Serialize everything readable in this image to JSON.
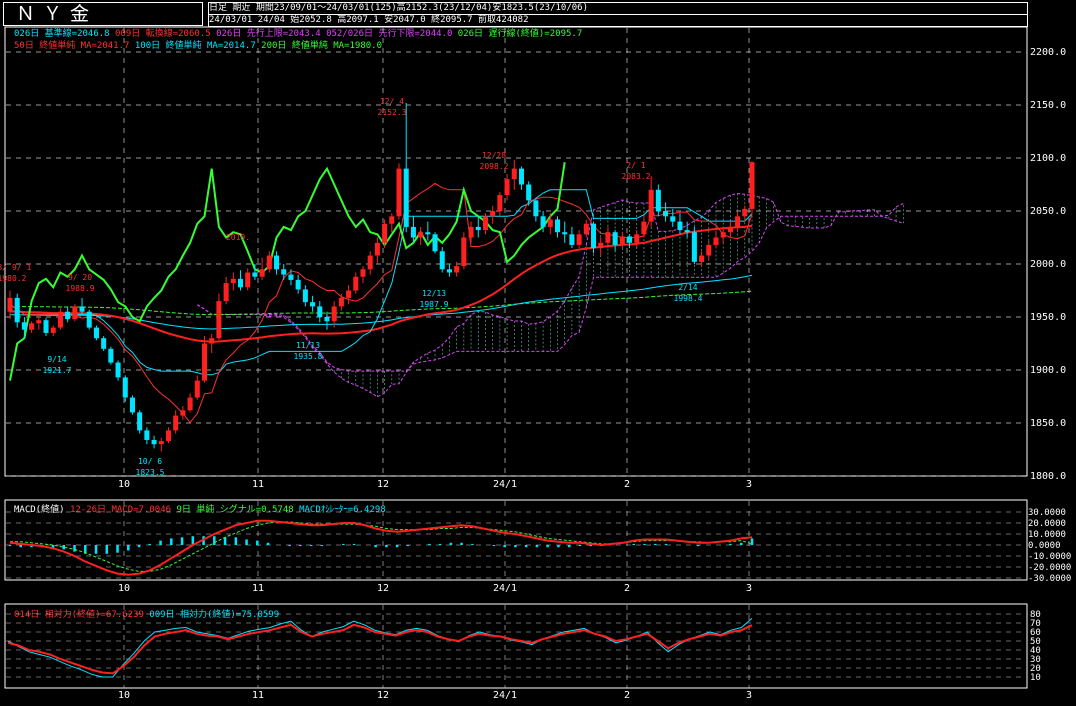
{
  "header": {
    "title": "ＮＹ金",
    "period_label": "日足 期近",
    "range_info": "期間23/09/01～24/03/01(125)高2152.3(23/12/04)安1823.5(23/10/06)",
    "ohlc_info": "24/03/01 24/04 始2052.8 高2097.1 安2047.0 終2095.7 前取424082"
  },
  "legends": {
    "ichimoku": [
      {
        "text": "026日 基準線=2046.8",
        "color": "#00e5ff"
      },
      {
        "text": "009日 転換線=2060.5",
        "color": "#ff3030"
      },
      {
        "text": "026日 先行上限=2043.4",
        "color": "#e040fb"
      },
      {
        "text": "052/026日 先行下限=2044.0",
        "color": "#e040fb"
      },
      {
        "text": "026日 遅行線(終値)=2095.7",
        "color": "#33ff33"
      }
    ],
    "ma": [
      {
        "text": "50日 終値単純 MA=2041.7",
        "color": "#ff3030"
      },
      {
        "text": "100日 終値単純 MA=2014.7",
        "color": "#00e5ff"
      },
      {
        "text": "200日 終値単純 MA=1980.0",
        "color": "#33ff33"
      }
    ],
    "macd": [
      {
        "text": "MACD(終値)",
        "color": "#ffffff"
      },
      {
        "text": "12-26日 MACD=7.0046",
        "color": "#ff3030"
      },
      {
        "text": "9日 単純 シグナル=0.5748",
        "color": "#33ff33"
      },
      {
        "text": "MACDｵｼﾚｰﾀｰ=6.4298",
        "color": "#00e5ff"
      }
    ],
    "rsi": [
      {
        "text": "014日 相対力(終値)=67.6239",
        "color": "#ff3030"
      },
      {
        "text": "009日 相対力(終値)=75.0599",
        "color": "#00e5ff"
      }
    ]
  },
  "colors": {
    "up": "#ff2020",
    "down": "#00e5ff",
    "ma50": "#ff2020",
    "ma100": "#00e5ff",
    "ma200": "#33ff33",
    "kijun": "#00e5ff",
    "tenkan": "#ff3030",
    "chikou": "#33ff33",
    "cloud": "#e040fb",
    "grid": "#cccccc"
  },
  "chart_data": [
    {
      "type": "candlestick",
      "title": "ＮＹ金",
      "ylim": [
        1800,
        2200
      ],
      "y_ticks": [
        "2200.0",
        "2150.0",
        "2100.0",
        "2050.0",
        "2000.0",
        "1950.0",
        "1900.0",
        "1850.0",
        "1800.0"
      ],
      "x_ticks": [
        "10",
        "11",
        "12",
        "24/1",
        "2",
        "3"
      ],
      "annotations": [
        "23/ 9/ 1 1980.2",
        "9/ 20 1988.9",
        "9/14 1921.7",
        "10/ 6 1823.5",
        "2019.",
        "11/13 1935.8",
        "12/ 4 2152.3",
        "12/13 1987.9",
        "12/28 2098.2",
        "2/ 1 2083.2",
        "2/14 1998.4"
      ],
      "candles": [
        {
          "o": 1955,
          "h": 1975,
          "l": 1948,
          "c": 1968
        },
        {
          "o": 1968,
          "h": 1972,
          "l": 1940,
          "c": 1945
        },
        {
          "o": 1945,
          "h": 1950,
          "l": 1930,
          "c": 1938
        },
        {
          "o": 1938,
          "h": 1946,
          "l": 1935,
          "c": 1944
        },
        {
          "o": 1944,
          "h": 1950,
          "l": 1938,
          "c": 1947
        },
        {
          "o": 1947,
          "h": 1949,
          "l": 1932,
          "c": 1935
        },
        {
          "o": 1935,
          "h": 1942,
          "l": 1932,
          "c": 1940
        },
        {
          "o": 1940,
          "h": 1958,
          "l": 1938,
          "c": 1955
        },
        {
          "o": 1955,
          "h": 1960,
          "l": 1945,
          "c": 1948
        },
        {
          "o": 1948,
          "h": 1962,
          "l": 1946,
          "c": 1960
        },
        {
          "o": 1960,
          "h": 1968,
          "l": 1952,
          "c": 1955
        },
        {
          "o": 1955,
          "h": 1957,
          "l": 1938,
          "c": 1940
        },
        {
          "o": 1940,
          "h": 1942,
          "l": 1928,
          "c": 1930
        },
        {
          "o": 1930,
          "h": 1932,
          "l": 1918,
          "c": 1920
        },
        {
          "o": 1920,
          "h": 1922,
          "l": 1905,
          "c": 1907
        },
        {
          "o": 1907,
          "h": 1909,
          "l": 1890,
          "c": 1893
        },
        {
          "o": 1893,
          "h": 1895,
          "l": 1870,
          "c": 1874
        },
        {
          "o": 1874,
          "h": 1876,
          "l": 1858,
          "c": 1860
        },
        {
          "o": 1860,
          "h": 1862,
          "l": 1840,
          "c": 1843
        },
        {
          "o": 1843,
          "h": 1846,
          "l": 1830,
          "c": 1834
        },
        {
          "o": 1834,
          "h": 1838,
          "l": 1826,
          "c": 1830
        },
        {
          "o": 1830,
          "h": 1836,
          "l": 1823,
          "c": 1833
        },
        {
          "o": 1833,
          "h": 1846,
          "l": 1831,
          "c": 1843
        },
        {
          "o": 1843,
          "h": 1862,
          "l": 1840,
          "c": 1857
        },
        {
          "o": 1857,
          "h": 1866,
          "l": 1853,
          "c": 1862
        },
        {
          "o": 1862,
          "h": 1878,
          "l": 1860,
          "c": 1874
        },
        {
          "o": 1874,
          "h": 1895,
          "l": 1872,
          "c": 1890
        },
        {
          "o": 1890,
          "h": 1932,
          "l": 1888,
          "c": 1925
        },
        {
          "o": 1925,
          "h": 1934,
          "l": 1916,
          "c": 1930
        },
        {
          "o": 1930,
          "h": 1972,
          "l": 1928,
          "c": 1965
        },
        {
          "o": 1965,
          "h": 1988,
          "l": 1962,
          "c": 1982
        },
        {
          "o": 1982,
          "h": 1992,
          "l": 1975,
          "c": 1986
        },
        {
          "o": 1986,
          "h": 1994,
          "l": 1975,
          "c": 1978
        },
        {
          "o": 1978,
          "h": 1996,
          "l": 1975,
          "c": 1992
        },
        {
          "o": 1992,
          "h": 2000,
          "l": 1985,
          "c": 1988
        },
        {
          "o": 1988,
          "h": 2006,
          "l": 1985,
          "c": 1995
        },
        {
          "o": 1995,
          "h": 2012,
          "l": 1992,
          "c": 2008
        },
        {
          "o": 2008,
          "h": 2012,
          "l": 1990,
          "c": 1995
        },
        {
          "o": 1995,
          "h": 2000,
          "l": 1985,
          "c": 1990
        },
        {
          "o": 1990,
          "h": 1995,
          "l": 1980,
          "c": 1985
        },
        {
          "o": 1985,
          "h": 1990,
          "l": 1972,
          "c": 1976
        },
        {
          "o": 1976,
          "h": 1980,
          "l": 1960,
          "c": 1964
        },
        {
          "o": 1964,
          "h": 1970,
          "l": 1955,
          "c": 1960
        },
        {
          "o": 1960,
          "h": 1965,
          "l": 1945,
          "c": 1950
        },
        {
          "o": 1950,
          "h": 1955,
          "l": 1938,
          "c": 1946
        },
        {
          "o": 1946,
          "h": 1965,
          "l": 1940,
          "c": 1960
        },
        {
          "o": 1960,
          "h": 1972,
          "l": 1956,
          "c": 1968
        },
        {
          "o": 1968,
          "h": 1980,
          "l": 1962,
          "c": 1975
        },
        {
          "o": 1975,
          "h": 1992,
          "l": 1972,
          "c": 1988
        },
        {
          "o": 1988,
          "h": 1998,
          "l": 1982,
          "c": 1995
        },
        {
          "o": 1995,
          "h": 2012,
          "l": 1990,
          "c": 2008
        },
        {
          "o": 2008,
          "h": 2025,
          "l": 2000,
          "c": 2020
        },
        {
          "o": 2020,
          "h": 2042,
          "l": 2015,
          "c": 2038
        },
        {
          "o": 2038,
          "h": 2048,
          "l": 2030,
          "c": 2045
        },
        {
          "o": 2045,
          "h": 2095,
          "l": 2042,
          "c": 2090
        },
        {
          "o": 2090,
          "h": 2152,
          "l": 2030,
          "c": 2035
        },
        {
          "o": 2035,
          "h": 2045,
          "l": 2020,
          "c": 2025
        },
        {
          "o": 2025,
          "h": 2035,
          "l": 2018,
          "c": 2030
        },
        {
          "o": 2030,
          "h": 2040,
          "l": 2022,
          "c": 2028
        },
        {
          "o": 2028,
          "h": 2030,
          "l": 2010,
          "c": 2012
        },
        {
          "o": 2012,
          "h": 2016,
          "l": 1992,
          "c": 1995
        },
        {
          "o": 1995,
          "h": 2000,
          "l": 1988,
          "c": 1992
        },
        {
          "o": 1992,
          "h": 2002,
          "l": 1988,
          "c": 1998
        },
        {
          "o": 1998,
          "h": 2030,
          "l": 1995,
          "c": 2025
        },
        {
          "o": 2025,
          "h": 2040,
          "l": 2020,
          "c": 2035
        },
        {
          "o": 2035,
          "h": 2045,
          "l": 2025,
          "c": 2032
        },
        {
          "o": 2032,
          "h": 2048,
          "l": 2028,
          "c": 2045
        },
        {
          "o": 2045,
          "h": 2055,
          "l": 2038,
          "c": 2050
        },
        {
          "o": 2050,
          "h": 2068,
          "l": 2045,
          "c": 2065
        },
        {
          "o": 2065,
          "h": 2085,
          "l": 2060,
          "c": 2080
        },
        {
          "o": 2080,
          "h": 2098,
          "l": 2070,
          "c": 2090
        },
        {
          "o": 2090,
          "h": 2092,
          "l": 2070,
          "c": 2075
        },
        {
          "o": 2075,
          "h": 2078,
          "l": 2055,
          "c": 2060
        },
        {
          "o": 2060,
          "h": 2062,
          "l": 2040,
          "c": 2045
        },
        {
          "o": 2045,
          "h": 2050,
          "l": 2030,
          "c": 2035
        },
        {
          "o": 2035,
          "h": 2048,
          "l": 2028,
          "c": 2042
        },
        {
          "o": 2042,
          "h": 2045,
          "l": 2025,
          "c": 2030
        },
        {
          "o": 2030,
          "h": 2040,
          "l": 2020,
          "c": 2028
        },
        {
          "o": 2028,
          "h": 2035,
          "l": 2015,
          "c": 2018
        },
        {
          "o": 2018,
          "h": 2032,
          "l": 2015,
          "c": 2028
        },
        {
          "o": 2028,
          "h": 2042,
          "l": 2025,
          "c": 2038
        },
        {
          "o": 2038,
          "h": 2040,
          "l": 2010,
          "c": 2015
        },
        {
          "o": 2015,
          "h": 2025,
          "l": 2008,
          "c": 2020
        },
        {
          "o": 2020,
          "h": 2035,
          "l": 2015,
          "c": 2030
        },
        {
          "o": 2030,
          "h": 2032,
          "l": 2012,
          "c": 2018
        },
        {
          "o": 2018,
          "h": 2030,
          "l": 2015,
          "c": 2026
        },
        {
          "o": 2026,
          "h": 2028,
          "l": 2015,
          "c": 2020
        },
        {
          "o": 2020,
          "h": 2032,
          "l": 2015,
          "c": 2028
        },
        {
          "o": 2028,
          "h": 2045,
          "l": 2025,
          "c": 2040
        },
        {
          "o": 2040,
          "h": 2083,
          "l": 2035,
          "c": 2070
        },
        {
          "o": 2070,
          "h": 2075,
          "l": 2045,
          "c": 2050
        },
        {
          "o": 2050,
          "h": 2058,
          "l": 2040,
          "c": 2045
        },
        {
          "o": 2045,
          "h": 2052,
          "l": 2035,
          "c": 2040
        },
        {
          "o": 2040,
          "h": 2048,
          "l": 2028,
          "c": 2032
        },
        {
          "o": 2032,
          "h": 2040,
          "l": 2025,
          "c": 2030
        },
        {
          "o": 2030,
          "h": 2035,
          "l": 2000,
          "c": 2002
        },
        {
          "o": 2002,
          "h": 2012,
          "l": 1998,
          "c": 2008
        },
        {
          "o": 2008,
          "h": 2022,
          "l": 2004,
          "c": 2018
        },
        {
          "o": 2018,
          "h": 2030,
          "l": 2015,
          "c": 2025
        },
        {
          "o": 2025,
          "h": 2035,
          "l": 2020,
          "c": 2030
        },
        {
          "o": 2030,
          "h": 2040,
          "l": 2025,
          "c": 2035
        },
        {
          "o": 2035,
          "h": 2050,
          "l": 2030,
          "c": 2045
        },
        {
          "o": 2045,
          "h": 2055,
          "l": 2040,
          "c": 2052
        },
        {
          "o": 2052,
          "h": 2097,
          "l": 2047,
          "c": 2096
        }
      ]
    },
    {
      "type": "line",
      "title": "MACD(終値)",
      "ylim": [
        -30,
        30
      ],
      "y_ticks": [
        "30.0000",
        "20.0000",
        "10.0000",
        "0.0000",
        "-10.0000",
        "-20.0000",
        "-30.0000"
      ],
      "series": [
        {
          "name": "12-26日 MACD",
          "values": [
            2,
            1,
            0,
            -1,
            -3,
            -6,
            -10,
            -15,
            -19,
            -23,
            -26,
            -27,
            -26,
            -23,
            -18,
            -12,
            -6,
            0,
            5,
            10,
            14,
            18,
            20,
            22,
            22,
            21,
            20,
            19,
            18,
            18,
            19,
            20,
            20,
            18,
            15,
            13,
            12,
            13,
            14,
            15,
            16,
            17,
            18,
            17,
            15,
            13,
            11,
            10,
            8,
            6,
            4,
            3,
            2,
            2,
            1,
            0,
            1,
            2,
            4,
            5,
            5,
            5,
            4,
            3,
            2,
            2,
            3,
            4,
            6,
            7
          ]
        },
        {
          "name": "9日 単純 シグナル",
          "values": [
            3,
            3,
            2,
            1,
            0,
            -2,
            -4,
            -7,
            -11,
            -15,
            -19,
            -22,
            -24,
            -24,
            -22,
            -18,
            -13,
            -8,
            -3,
            2,
            7,
            11,
            15,
            18,
            20,
            21,
            21,
            20,
            19,
            19,
            19,
            19,
            19,
            18,
            17,
            15,
            14,
            14,
            14,
            14,
            15,
            15,
            16,
            16,
            15,
            14,
            13,
            12,
            10,
            8,
            6,
            5,
            4,
            3,
            2,
            1,
            1,
            2,
            3,
            4,
            4,
            4,
            4,
            3,
            3,
            2,
            3,
            3,
            4,
            1
          ]
        },
        {
          "name": "MACDｵｼﾚｰﾀｰ",
          "values": [
            -1,
            -2,
            -2,
            -2,
            -3,
            -4,
            -6,
            -8,
            -8,
            -8,
            -7,
            -5,
            -2,
            1,
            4,
            6,
            7,
            8,
            8,
            8,
            7,
            7,
            5,
            4,
            2,
            0,
            -1,
            -1,
            -1,
            -1,
            0,
            1,
            1,
            0,
            -2,
            -2,
            -2,
            -1,
            0,
            1,
            1,
            2,
            2,
            1,
            0,
            -1,
            -2,
            -2,
            -2,
            -2,
            -2,
            -2,
            -2,
            -1,
            -1,
            -1,
            0,
            0,
            1,
            1,
            1,
            1,
            0,
            0,
            -1,
            0,
            0,
            1,
            2,
            6
          ]
        }
      ]
    },
    {
      "type": "line",
      "title": "014日 相対力(終値)",
      "ylim": [
        0,
        80
      ],
      "y_ticks": [
        "80",
        "70",
        "60",
        "50",
        "40",
        "30",
        "20",
        "10"
      ],
      "series": [
        {
          "name": "014日 相対力",
          "values": [
            48,
            45,
            40,
            38,
            35,
            30,
            26,
            22,
            18,
            15,
            14,
            22,
            32,
            45,
            55,
            58,
            60,
            62,
            58,
            56,
            55,
            52,
            55,
            58,
            60,
            62,
            65,
            68,
            60,
            55,
            58,
            60,
            62,
            68,
            65,
            60,
            58,
            56,
            60,
            62,
            60,
            55,
            52,
            50,
            55,
            58,
            56,
            55,
            52,
            50,
            48,
            52,
            55,
            58,
            60,
            62,
            58,
            55,
            50,
            52,
            55,
            58,
            50,
            42,
            48,
            52,
            55,
            58,
            56,
            60,
            62,
            67.6
          ]
        },
        {
          "name": "009日 相対力",
          "values": [
            50,
            44,
            38,
            35,
            32,
            27,
            22,
            18,
            13,
            10,
            10,
            24,
            36,
            50,
            60,
            62,
            64,
            65,
            60,
            58,
            56,
            53,
            57,
            61,
            63,
            65,
            69,
            72,
            62,
            55,
            60,
            63,
            66,
            72,
            68,
            62,
            59,
            57,
            62,
            64,
            62,
            56,
            52,
            49,
            56,
            60,
            57,
            55,
            51,
            49,
            46,
            52,
            56,
            60,
            62,
            64,
            58,
            54,
            48,
            51,
            55,
            60,
            48,
            38,
            46,
            52,
            56,
            60,
            57,
            62,
            65,
            75.1
          ]
        }
      ]
    }
  ]
}
